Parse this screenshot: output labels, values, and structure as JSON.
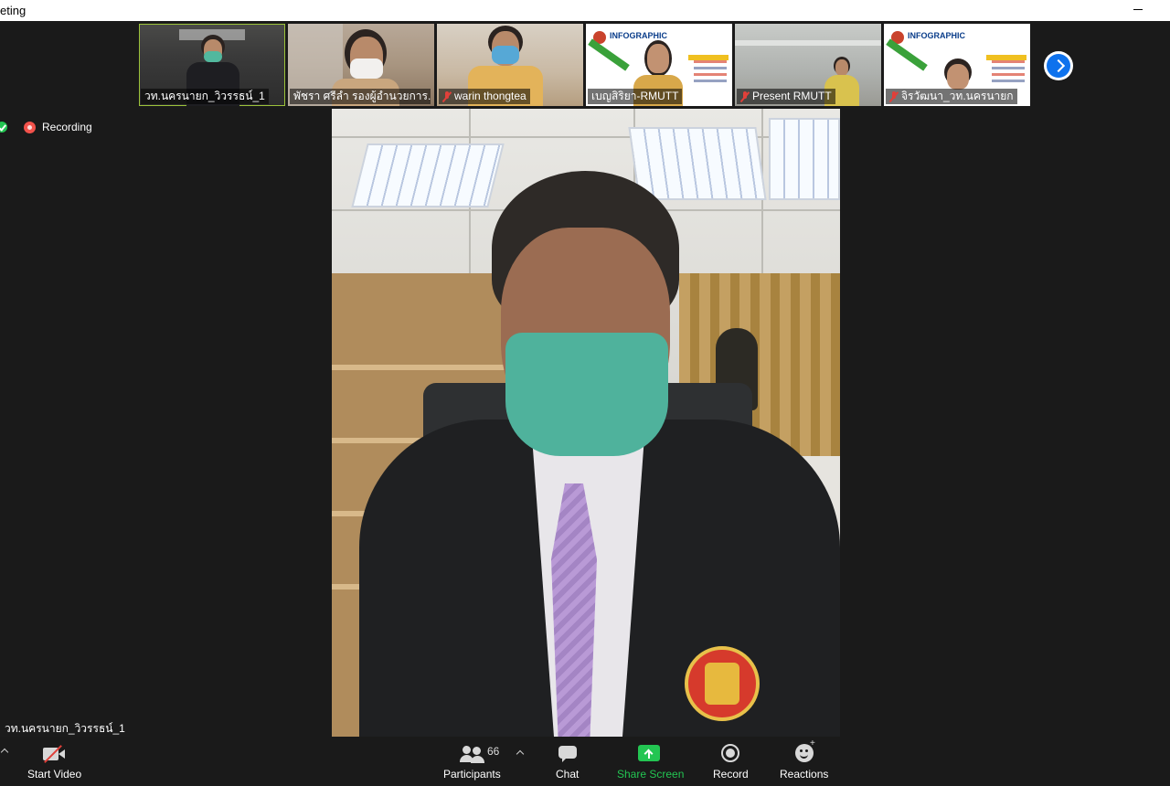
{
  "window": {
    "title": "eting"
  },
  "status": {
    "recording_label": "Recording"
  },
  "participants": [
    {
      "name": "วท.นครนายก_วิวรรธน์_1",
      "muted": false,
      "active": true
    },
    {
      "name": "พัชรา ศรีลำ รองผู้อำนวยการ...",
      "muted": false,
      "active": false
    },
    {
      "name": "warin thongtea",
      "muted": true,
      "active": false
    },
    {
      "name": "เบญสิริยา-RMUTT",
      "muted": false,
      "active": false
    },
    {
      "name": "Present RMUTT",
      "muted": true,
      "active": false
    },
    {
      "name": "จิรวัฒนา_วท.นครนายก",
      "muted": true,
      "active": false
    }
  ],
  "poster": {
    "headline": "INFOGRAPHIC"
  },
  "speaker": {
    "name": "วท.นครนายก_วิวรรธน์_1"
  },
  "toolbar": {
    "start_video": "Start Video",
    "participants": "Participants",
    "participants_count": "66",
    "chat": "Chat",
    "share_screen": "Share Screen",
    "record": "Record",
    "reactions": "Reactions"
  },
  "colors": {
    "accent_green": "#23c552",
    "accent_blue": "#0e72ed",
    "recording_red": "#f2524b",
    "background": "#1a1a1a"
  },
  "icons": {
    "next": "chevron-right-icon",
    "video": "video-off-icon",
    "participants": "participants-icon",
    "chat": "chat-icon",
    "share": "share-screen-icon",
    "record": "record-icon",
    "reactions": "reactions-icon"
  }
}
